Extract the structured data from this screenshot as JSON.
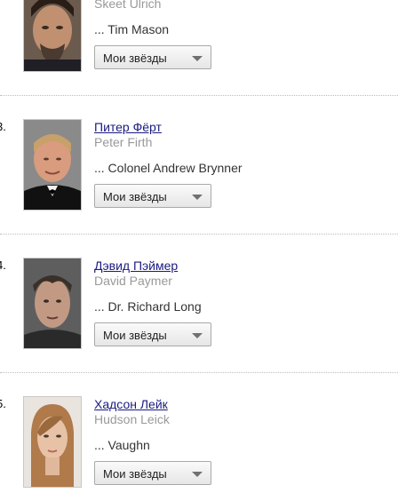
{
  "cast": [
    {
      "number": "",
      "name_ru": "",
      "name_en": "Skeet Ulrich",
      "role": "... Tim Mason",
      "button_label": "Мои звёзды",
      "photo_icon": "actor-photo"
    },
    {
      "number": "3.",
      "name_ru": "Питер Фёрт",
      "name_en": "Peter Firth",
      "role": "... Colonel Andrew Brynner",
      "button_label": "Мои звёзды",
      "photo_icon": "actor-photo"
    },
    {
      "number": "4.",
      "name_ru": "Дэвид Пэймер",
      "name_en": "David Paymer",
      "role": "... Dr. Richard Long",
      "button_label": "Мои звёзды",
      "photo_icon": "actor-photo"
    },
    {
      "number": "5.",
      "name_ru": "Хадсон Лейк",
      "name_en": "Hudson Leick",
      "role": "... Vaughn",
      "button_label": "Мои звёзды",
      "photo_icon": "actor-photo"
    }
  ],
  "colors": {
    "link": "#1a1a80",
    "secondary_text": "#999999",
    "role_text": "#333333",
    "divider": "#bdbdbd"
  }
}
